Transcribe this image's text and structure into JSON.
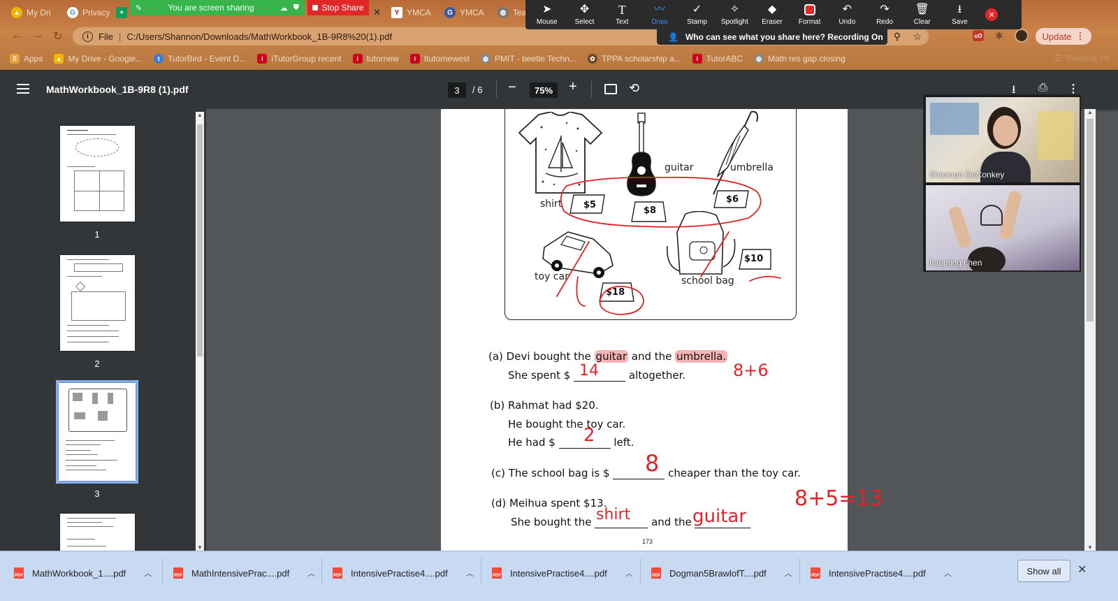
{
  "browser": {
    "tabs": [
      {
        "label": "My Dri",
        "icon": "drive-icon"
      },
      {
        "label": "Privacy",
        "icon": "google-icon"
      },
      {
        "label": "YMCA",
        "icon": "ymca-icon"
      },
      {
        "label": "YMCA",
        "icon": "google-icon"
      },
      {
        "label": "Tea",
        "icon": "globe-icon"
      }
    ],
    "share_banner": "You are screen sharing",
    "stop_share": "Stop Share",
    "address": {
      "prefix": "File",
      "url": "C:/Users/Shannon/Downloads/MathWorkbook_1B-9R8%20(1).pdf"
    },
    "update_label": "Update",
    "bookmarks": [
      {
        "label": "Apps",
        "icon": "apps-icon",
        "color": "#e8a33b"
      },
      {
        "label": "My Drive - Google...",
        "icon": "drive-icon",
        "color": "#f4b400"
      },
      {
        "label": "TutorBird - Event D...",
        "icon": "tutorbird-icon",
        "color": "#3a7bd5"
      },
      {
        "label": "iTutorGroup recent",
        "icon": "itutor-icon",
        "color": "#d0021b"
      },
      {
        "label": "tutornew",
        "icon": "itutor-icon",
        "color": "#d0021b"
      },
      {
        "label": "Itutornewest",
        "icon": "itutor-icon",
        "color": "#d0021b"
      },
      {
        "label": "PMIT - beetle Techn...",
        "icon": "globe-icon",
        "color": "#888888"
      },
      {
        "label": "TPPA scholarship a...",
        "icon": "tppa-icon",
        "color": "#6b4a2a"
      },
      {
        "label": "TutorABC",
        "icon": "itutor-icon",
        "color": "#d0021b"
      },
      {
        "label": "Math res gap closing",
        "icon": "globe-icon",
        "color": "#888888"
      }
    ],
    "reading_list": "Reading list"
  },
  "annotation_toolbar": {
    "tools": [
      {
        "label": "Mouse",
        "icon": "cursor-icon",
        "glyph": "➤"
      },
      {
        "label": "Select",
        "icon": "move-icon",
        "glyph": "✥"
      },
      {
        "label": "Text",
        "icon": "text-icon",
        "glyph": "T"
      },
      {
        "label": "Draw",
        "icon": "draw-icon",
        "glyph": "〰"
      },
      {
        "label": "Stamp",
        "icon": "check-icon",
        "glyph": "✓"
      },
      {
        "label": "Spotlight",
        "icon": "spotlight-icon",
        "glyph": "✧"
      },
      {
        "label": "Eraser",
        "icon": "eraser-icon",
        "glyph": "◆"
      },
      {
        "label": "Format",
        "icon": "format-icon",
        "glyph": ""
      },
      {
        "label": "Undo",
        "icon": "undo-icon",
        "glyph": "↶"
      },
      {
        "label": "Redo",
        "icon": "redo-icon",
        "glyph": "↷"
      },
      {
        "label": "Clear",
        "icon": "trash-icon",
        "glyph": "🗑"
      },
      {
        "label": "Save",
        "icon": "save-icon",
        "glyph": "⭳"
      }
    ],
    "active_tool": "Draw",
    "recording_notice": "Who can see what you share here? Recording On"
  },
  "pdf": {
    "title": "MathWorkbook_1B-9R8 (1).pdf",
    "current_page": "3",
    "total_pages": "/ 6",
    "zoom": "75%",
    "thumbnails": [
      {
        "label": "1"
      },
      {
        "label": "2"
      },
      {
        "label": "3"
      }
    ],
    "selected_page": "3"
  },
  "worksheet": {
    "items": {
      "shirt": {
        "label": "shirt",
        "price": "$5"
      },
      "guitar": {
        "label": "guitar",
        "price": "$8"
      },
      "umbrella": {
        "label": "umbrella",
        "price": "$6"
      },
      "toy_car": {
        "label": "toy car",
        "price": "$18"
      },
      "school_bag": {
        "label": "school bag",
        "price": "$10"
      }
    },
    "q_a": {
      "line1_a": "(a) Devi bought the",
      "hl1": "guitar",
      "mid": "and the",
      "hl2": "umbrella.",
      "line2_a": "She spent $",
      "line2_b": "altogether.",
      "answer": "14",
      "work": "8+6"
    },
    "q_b": {
      "line1": "(b) Rahmat had $20.",
      "line2": "He bought the toy car.",
      "line3_a": "He had $",
      "line3_b": "left.",
      "answer": "2"
    },
    "q_c": {
      "line_a": "(c) The school bag is $",
      "line_b": "cheaper than the toy car.",
      "answer": "8"
    },
    "q_d": {
      "line1": "(d) Meihua spent $13.",
      "line2_a": "She bought the",
      "line2_b": "and the",
      "answer1": "shirt",
      "answer2": "guitar",
      "work": "8+5=13"
    },
    "page_number": "173"
  },
  "video": {
    "participants": [
      {
        "name": "Shannon DeConkey"
      },
      {
        "name": "haoming   chen"
      }
    ]
  },
  "downloads": {
    "items": [
      {
        "name": "MathWorkbook_1....pdf"
      },
      {
        "name": "MathIntensivePrac....pdf"
      },
      {
        "name": "IntensivePractise4....pdf"
      },
      {
        "name": "IntensivePractise4....pdf"
      },
      {
        "name": "Dogman5BrawlofT....pdf"
      },
      {
        "name": "IntensivePractise4....pdf"
      }
    ],
    "show_all": "Show all"
  }
}
